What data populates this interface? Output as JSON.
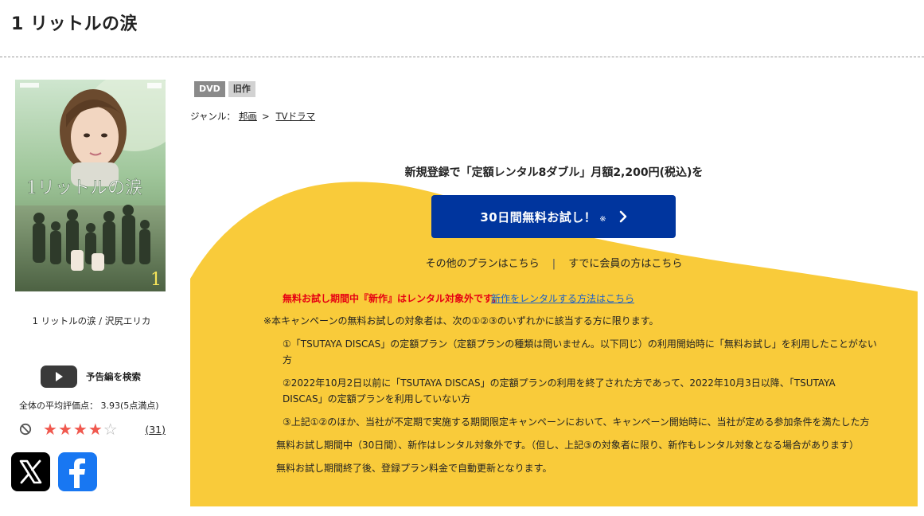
{
  "page": {
    "title": "1 リットルの涙"
  },
  "cover": {
    "title_art": "1リットルの涙",
    "volume": "1",
    "caption": "1 リットルの涙 / 沢尻エリカ"
  },
  "trailer": {
    "label": "予告編を検索"
  },
  "rating": {
    "text": "全体の平均評価点： 3.93(5点満点)",
    "stars_filled": 4,
    "stars_total": 5,
    "star_on_color": "#f0584e",
    "count": "31"
  },
  "social": {
    "x_icon": "x-logo-icon",
    "facebook_icon": "facebook-logo-icon"
  },
  "badges": {
    "format": "DVD",
    "status": "旧作"
  },
  "genre": {
    "label": "ジャンル：",
    "crumbs": [
      "邦画",
      "TVドラマ"
    ],
    "separator": ">"
  },
  "promo": {
    "headline": "新規登録で「定額レンタル8ダブル」月額2,200円(税込)を",
    "cta_label": "30日間無料お試し！",
    "cta_mark": "※",
    "cta_color": "#00359e",
    "other_plans": "その他のプランはこちら",
    "divider": "|",
    "member_link": "すでに会員の方はこちら",
    "panel_color": "#f9cb3a"
  },
  "notes": {
    "red": "無料お試し期間中『新作』はレンタル対象外です。",
    "red_link": "新作をレンタルする方法はこちら",
    "intro": "※本キャンペーンの無料お試しの対象者は、次の①②③のいずれかに該当する方に限ります。",
    "item1_a": "①「TSUTAYA DISCAS」の定額プラン（定額プランの種類は問いません。以下同じ）の利用開始時に「無料お試し」を利用したことがない",
    "item1_b": "方",
    "item2_a": "②2022年10月2日以前に「TSUTAYA DISCAS」の定額プランの利用を終了された方であって、2022年10月3日以降、「TSUTAYA",
    "item2_b": "DISCAS」の定額プランを利用していない方",
    "item3": "③上記①②のほか、当社が不定期で実施する期間限定キャンペーンにおいて、キャンペーン開始時に、当社が定める参加条件を満たした方",
    "period": "無料お試し期間中（30日間）、新作はレンタル対象外です。（但し、上記③の対象者に限り、新作もレンタル対象となる場合があります）",
    "renew": "無料お試し期間終了後、登録プラン料金で自動更新となります。"
  }
}
